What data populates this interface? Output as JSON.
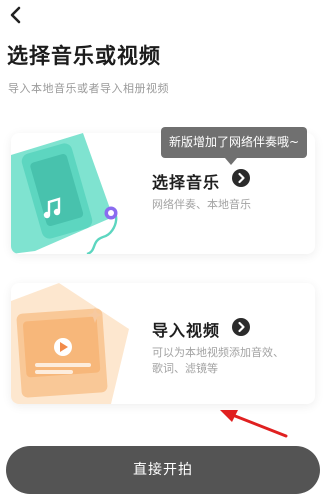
{
  "header": {
    "title": "选择音乐或视频",
    "subtitle": "导入本地音乐或者导入相册视频"
  },
  "icons": {
    "back": "chevron-left-icon",
    "music_card_arrow": "chevron-right-icon",
    "video_card_arrow": "chevron-right-icon"
  },
  "music_card": {
    "title": "选择音乐",
    "description": "网络伴奏、本地音乐",
    "tooltip": "新版增加了网络伴奏哦~"
  },
  "video_card": {
    "title": "导入视频",
    "description": "可以为本地视频添加音效、歌词、滤镜等"
  },
  "footer": {
    "start_label": "直接开拍"
  },
  "colors": {
    "music_accent": "#5dd6c0",
    "video_accent": "#f7b77a",
    "tooltip_bg": "#707070",
    "button_bg": "#545454",
    "annotation_red": "#e02020"
  }
}
